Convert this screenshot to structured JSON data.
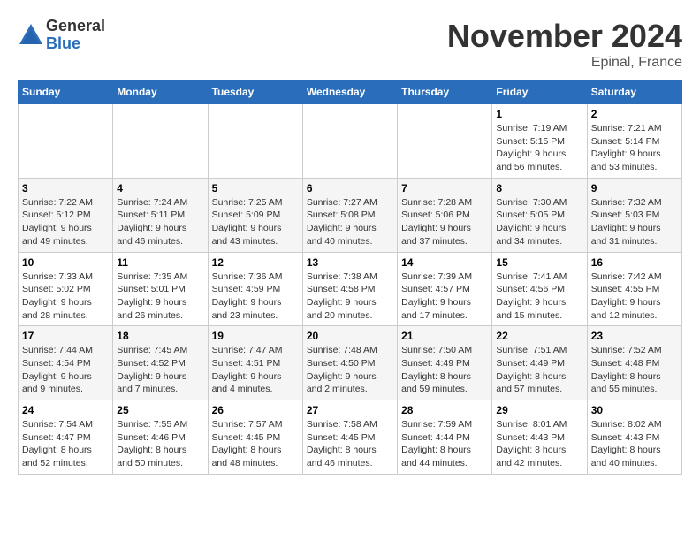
{
  "header": {
    "logo_general": "General",
    "logo_blue": "Blue",
    "month_title": "November 2024",
    "location": "Epinal, France"
  },
  "days_of_week": [
    "Sunday",
    "Monday",
    "Tuesday",
    "Wednesday",
    "Thursday",
    "Friday",
    "Saturday"
  ],
  "weeks": [
    [
      {
        "day": "",
        "info": ""
      },
      {
        "day": "",
        "info": ""
      },
      {
        "day": "",
        "info": ""
      },
      {
        "day": "",
        "info": ""
      },
      {
        "day": "",
        "info": ""
      },
      {
        "day": "1",
        "info": "Sunrise: 7:19 AM\nSunset: 5:15 PM\nDaylight: 9 hours and 56 minutes."
      },
      {
        "day": "2",
        "info": "Sunrise: 7:21 AM\nSunset: 5:14 PM\nDaylight: 9 hours and 53 minutes."
      }
    ],
    [
      {
        "day": "3",
        "info": "Sunrise: 7:22 AM\nSunset: 5:12 PM\nDaylight: 9 hours and 49 minutes."
      },
      {
        "day": "4",
        "info": "Sunrise: 7:24 AM\nSunset: 5:11 PM\nDaylight: 9 hours and 46 minutes."
      },
      {
        "day": "5",
        "info": "Sunrise: 7:25 AM\nSunset: 5:09 PM\nDaylight: 9 hours and 43 minutes."
      },
      {
        "day": "6",
        "info": "Sunrise: 7:27 AM\nSunset: 5:08 PM\nDaylight: 9 hours and 40 minutes."
      },
      {
        "day": "7",
        "info": "Sunrise: 7:28 AM\nSunset: 5:06 PM\nDaylight: 9 hours and 37 minutes."
      },
      {
        "day": "8",
        "info": "Sunrise: 7:30 AM\nSunset: 5:05 PM\nDaylight: 9 hours and 34 minutes."
      },
      {
        "day": "9",
        "info": "Sunrise: 7:32 AM\nSunset: 5:03 PM\nDaylight: 9 hours and 31 minutes."
      }
    ],
    [
      {
        "day": "10",
        "info": "Sunrise: 7:33 AM\nSunset: 5:02 PM\nDaylight: 9 hours and 28 minutes."
      },
      {
        "day": "11",
        "info": "Sunrise: 7:35 AM\nSunset: 5:01 PM\nDaylight: 9 hours and 26 minutes."
      },
      {
        "day": "12",
        "info": "Sunrise: 7:36 AM\nSunset: 4:59 PM\nDaylight: 9 hours and 23 minutes."
      },
      {
        "day": "13",
        "info": "Sunrise: 7:38 AM\nSunset: 4:58 PM\nDaylight: 9 hours and 20 minutes."
      },
      {
        "day": "14",
        "info": "Sunrise: 7:39 AM\nSunset: 4:57 PM\nDaylight: 9 hours and 17 minutes."
      },
      {
        "day": "15",
        "info": "Sunrise: 7:41 AM\nSunset: 4:56 PM\nDaylight: 9 hours and 15 minutes."
      },
      {
        "day": "16",
        "info": "Sunrise: 7:42 AM\nSunset: 4:55 PM\nDaylight: 9 hours and 12 minutes."
      }
    ],
    [
      {
        "day": "17",
        "info": "Sunrise: 7:44 AM\nSunset: 4:54 PM\nDaylight: 9 hours and 9 minutes."
      },
      {
        "day": "18",
        "info": "Sunrise: 7:45 AM\nSunset: 4:52 PM\nDaylight: 9 hours and 7 minutes."
      },
      {
        "day": "19",
        "info": "Sunrise: 7:47 AM\nSunset: 4:51 PM\nDaylight: 9 hours and 4 minutes."
      },
      {
        "day": "20",
        "info": "Sunrise: 7:48 AM\nSunset: 4:50 PM\nDaylight: 9 hours and 2 minutes."
      },
      {
        "day": "21",
        "info": "Sunrise: 7:50 AM\nSunset: 4:49 PM\nDaylight: 8 hours and 59 minutes."
      },
      {
        "day": "22",
        "info": "Sunrise: 7:51 AM\nSunset: 4:49 PM\nDaylight: 8 hours and 57 minutes."
      },
      {
        "day": "23",
        "info": "Sunrise: 7:52 AM\nSunset: 4:48 PM\nDaylight: 8 hours and 55 minutes."
      }
    ],
    [
      {
        "day": "24",
        "info": "Sunrise: 7:54 AM\nSunset: 4:47 PM\nDaylight: 8 hours and 52 minutes."
      },
      {
        "day": "25",
        "info": "Sunrise: 7:55 AM\nSunset: 4:46 PM\nDaylight: 8 hours and 50 minutes."
      },
      {
        "day": "26",
        "info": "Sunrise: 7:57 AM\nSunset: 4:45 PM\nDaylight: 8 hours and 48 minutes."
      },
      {
        "day": "27",
        "info": "Sunrise: 7:58 AM\nSunset: 4:45 PM\nDaylight: 8 hours and 46 minutes."
      },
      {
        "day": "28",
        "info": "Sunrise: 7:59 AM\nSunset: 4:44 PM\nDaylight: 8 hours and 44 minutes."
      },
      {
        "day": "29",
        "info": "Sunrise: 8:01 AM\nSunset: 4:43 PM\nDaylight: 8 hours and 42 minutes."
      },
      {
        "day": "30",
        "info": "Sunrise: 8:02 AM\nSunset: 4:43 PM\nDaylight: 8 hours and 40 minutes."
      }
    ]
  ]
}
